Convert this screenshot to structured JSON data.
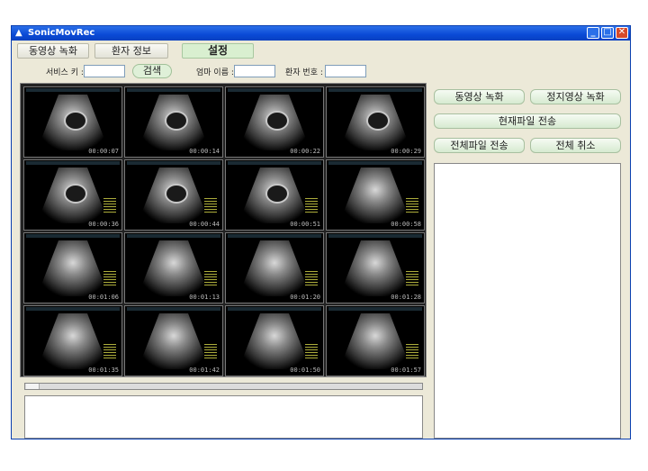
{
  "window": {
    "title": "SonicMovRec",
    "controls": [
      "minimize",
      "maximize",
      "close"
    ]
  },
  "nav": {
    "tabs": [
      "동영상 녹화",
      "환자 정보",
      "설정"
    ],
    "active": "설정"
  },
  "search": {
    "service_key_label": "서비스 키 :",
    "service_key_value": "",
    "search_button": "검색",
    "mother_name_label": "엄마 이름 :",
    "mother_name_value": "",
    "patient_no_label": "환자 번호 :",
    "patient_no_value": ""
  },
  "thumbnails": [
    {
      "time": "00:00:07"
    },
    {
      "time": "00:00:14"
    },
    {
      "time": "00:00:22"
    },
    {
      "time": "00:00:29"
    },
    {
      "time": "00:00:36"
    },
    {
      "time": "00:00:44"
    },
    {
      "time": "00:00:51"
    },
    {
      "time": "00:00:58"
    },
    {
      "time": "00:01:06"
    },
    {
      "time": "00:01:13"
    },
    {
      "time": "00:01:20"
    },
    {
      "time": "00:01:28"
    },
    {
      "time": "00:01:35"
    },
    {
      "time": "00:01:42"
    },
    {
      "time": "00:01:50"
    },
    {
      "time": "00:01:57"
    }
  ],
  "actions": {
    "record_video": "동영상 녹화",
    "record_still": "정지영상 녹화",
    "send_current": "현재파일 전송",
    "send_all": "전체파일 전송",
    "cancel_all": "전체 취소"
  }
}
